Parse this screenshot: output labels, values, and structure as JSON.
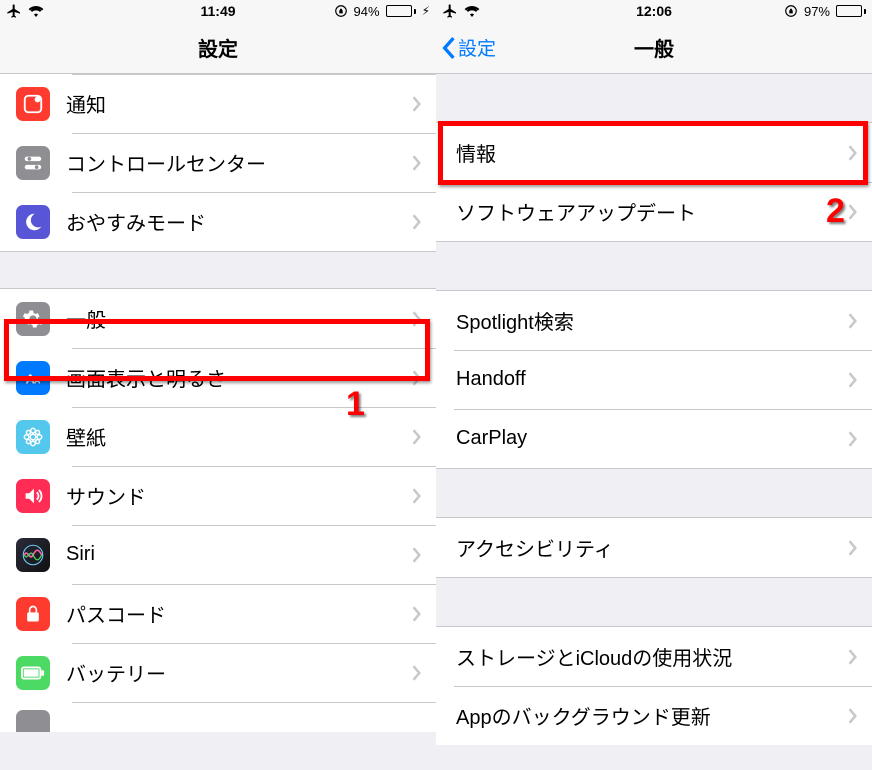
{
  "left": {
    "status": {
      "time": "11:49",
      "battery_pct": "94%",
      "battery_fill": 94,
      "battery_color": "#4cd964",
      "charging": true
    },
    "nav": {
      "title": "設定"
    },
    "group1": [
      {
        "key": "notifications",
        "label": "通知",
        "icon": "notif",
        "bg": "#ff3b30"
      },
      {
        "key": "controlcenter",
        "label": "コントロールセンター",
        "icon": "toggles",
        "bg": "#8e8e93"
      },
      {
        "key": "dnd",
        "label": "おやすみモード",
        "icon": "moon",
        "bg": "#5856d6"
      }
    ],
    "group2": [
      {
        "key": "general",
        "label": "一般",
        "icon": "gear",
        "bg": "#8e8e93"
      },
      {
        "key": "display",
        "label": "画面表示と明るさ",
        "icon": "text",
        "bg": "#007aff"
      },
      {
        "key": "wallpaper",
        "label": "壁紙",
        "icon": "flower",
        "bg": "#54c7ec"
      },
      {
        "key": "sound",
        "label": "サウンド",
        "icon": "speaker",
        "bg": "#ff2d55"
      },
      {
        "key": "siri",
        "label": "Siri",
        "icon": "siri",
        "bg": "#000"
      },
      {
        "key": "passcode",
        "label": "パスコード",
        "icon": "lockpad",
        "bg": "#ff3b30"
      },
      {
        "key": "battery",
        "label": "バッテリー",
        "icon": "batt",
        "bg": "#4cd964"
      }
    ],
    "annot_num": "1"
  },
  "right": {
    "status": {
      "time": "12:06",
      "battery_pct": "97%",
      "battery_fill": 97,
      "battery_color": "#000",
      "charging": false
    },
    "nav": {
      "back": "設定",
      "title": "一般"
    },
    "group1": [
      {
        "key": "about",
        "label": "情報"
      },
      {
        "key": "swupdate",
        "label": "ソフトウェアアップデート"
      }
    ],
    "group2": [
      {
        "key": "spotlight",
        "label": "Spotlight検索"
      },
      {
        "key": "handoff",
        "label": "Handoff"
      },
      {
        "key": "carplay",
        "label": "CarPlay"
      }
    ],
    "group3": [
      {
        "key": "accessibility",
        "label": "アクセシビリティ"
      }
    ],
    "group4": [
      {
        "key": "storage",
        "label": "ストレージとiCloudの使用状況"
      },
      {
        "key": "bgrefresh",
        "label": "Appのバックグラウンド更新"
      }
    ],
    "annot_num": "2"
  }
}
